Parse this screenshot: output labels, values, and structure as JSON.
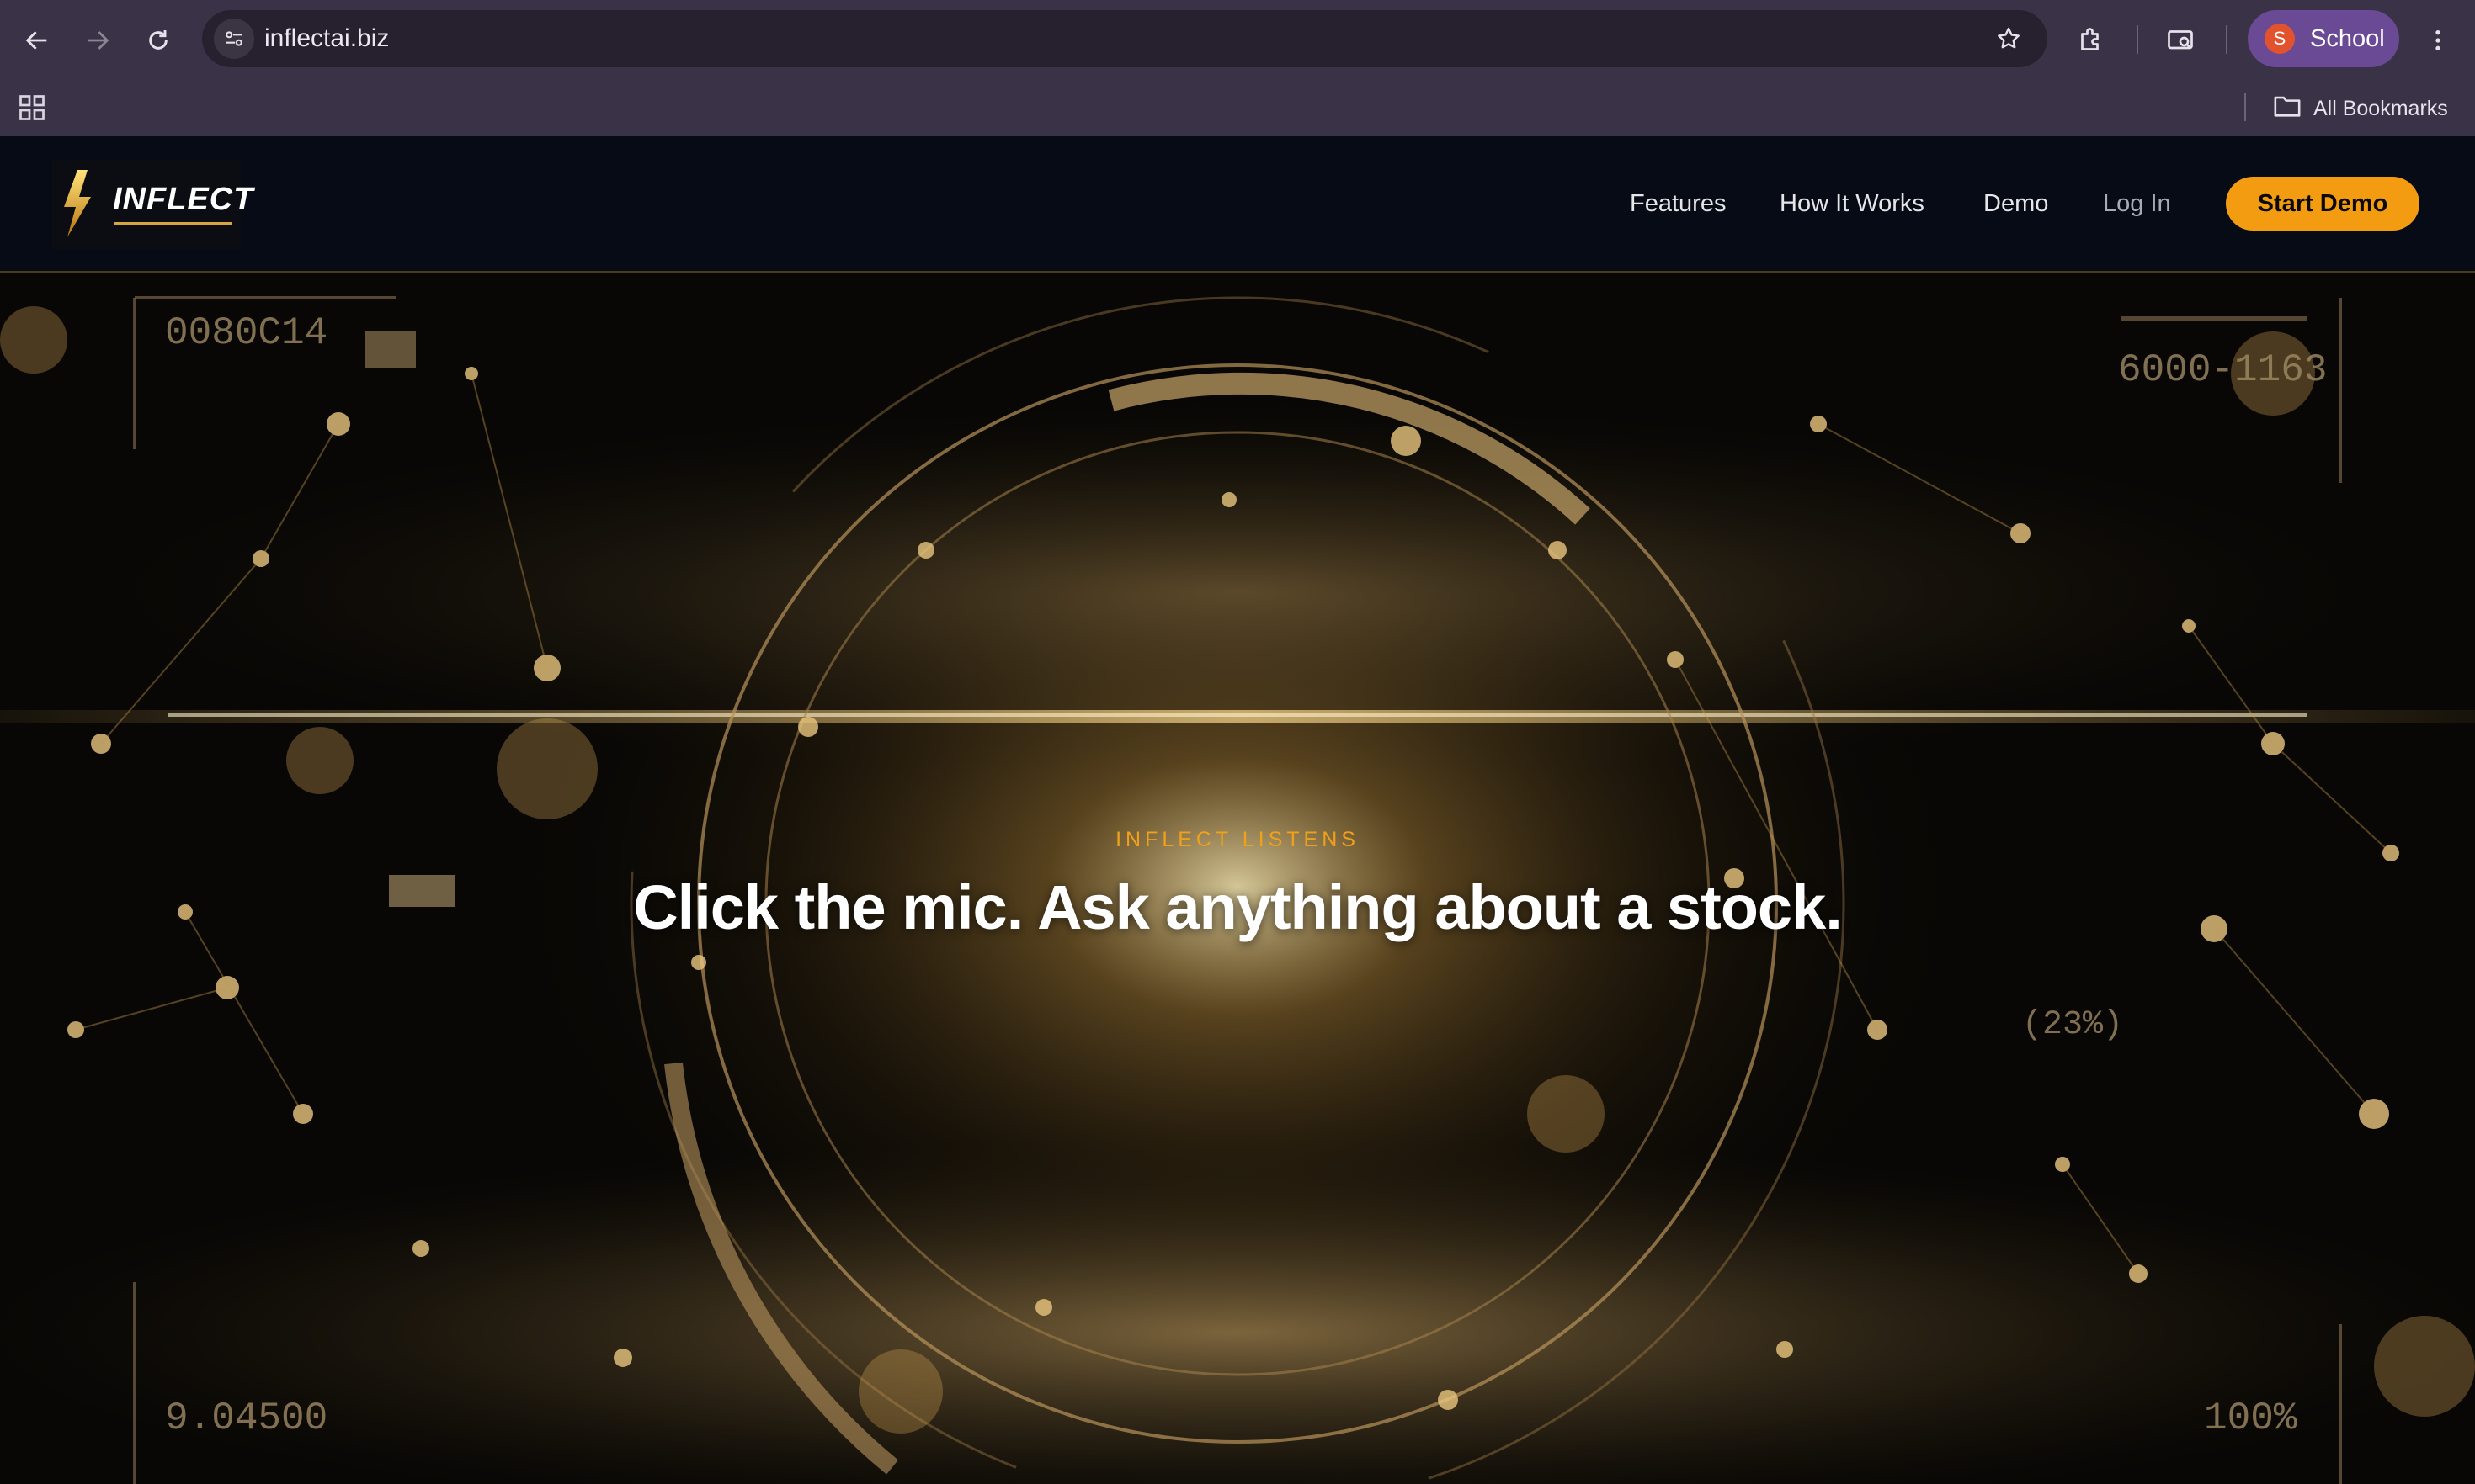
{
  "browser": {
    "url": "inflectai.biz",
    "profile_initial": "S",
    "profile_name": "School",
    "bookmarks_label": "All Bookmarks",
    "icons": [
      "back-icon",
      "forward-icon",
      "reload-icon",
      "site-info-icon",
      "star-icon",
      "extensions-icon",
      "cast-icon",
      "more-icon",
      "apps-icon",
      "folder-icon"
    ]
  },
  "header": {
    "logo_text": "INFLECT",
    "nav": [
      "Features",
      "How It Works",
      "Demo",
      "Log In"
    ],
    "cta": "Start Demo",
    "accent": "#f39c12"
  },
  "hero": {
    "kicker": "INFLECT LISTENS",
    "headline": "Click the mic. Ask anything about a stock.",
    "hud": [
      "0080C14",
      "6000-1163",
      "(23%)",
      "9.04500",
      "100%"
    ]
  }
}
